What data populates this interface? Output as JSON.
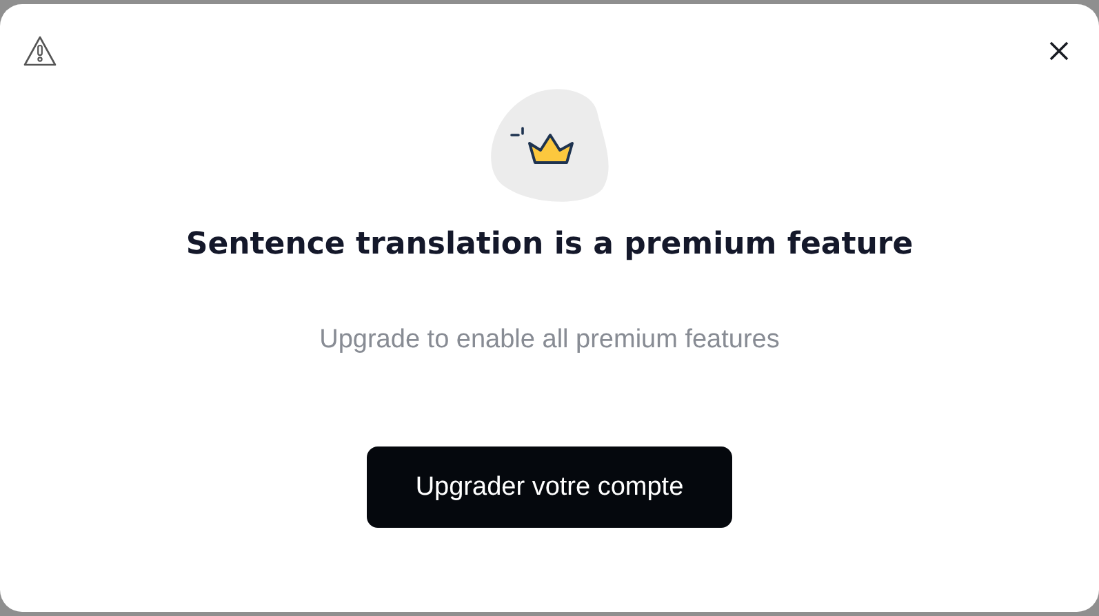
{
  "dialog": {
    "title": "Sentence translation is a premium feature",
    "subtitle": "Upgrade to enable all premium features",
    "button": "Upgrader votre compte"
  }
}
